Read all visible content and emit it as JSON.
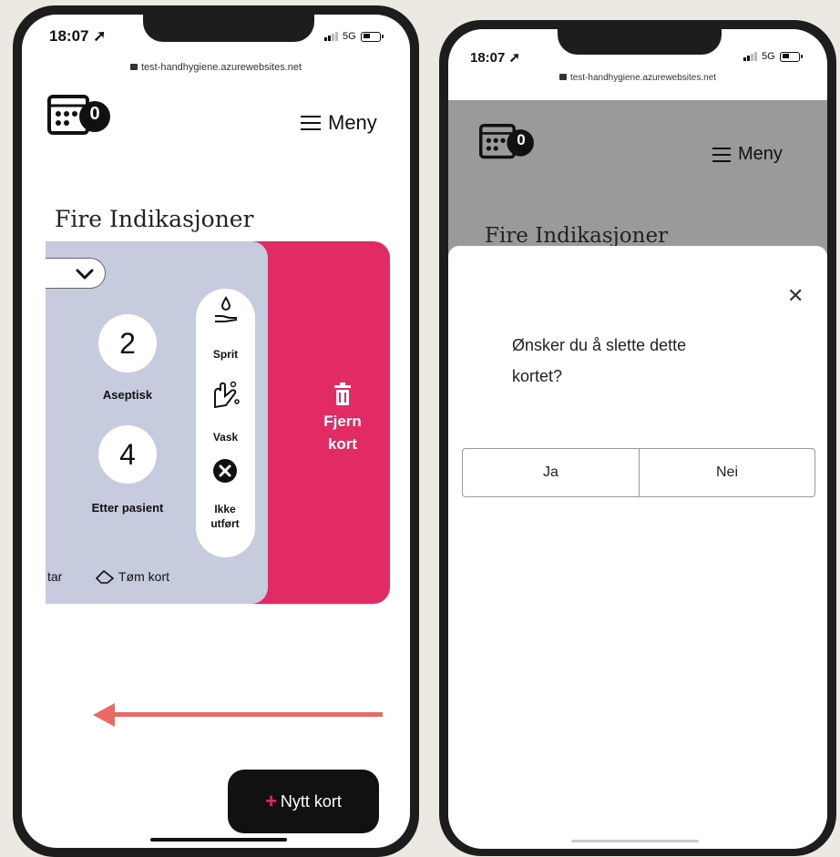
{
  "left_phone": {
    "status": {
      "time": "18:07",
      "network": "5G"
    },
    "url": "test-handhygiene.azurewebsites.net",
    "header": {
      "badge_count": "0",
      "menu_label": "Meny"
    },
    "page_title": "Fire Indikasjoner",
    "card": {
      "indications": [
        {
          "number": "2",
          "label": "Aseptisk"
        },
        {
          "number": "4",
          "label": "Etter pasient"
        }
      ],
      "actions": [
        {
          "label": "Sprit",
          "icon": "hand-sanitizer-icon"
        },
        {
          "label": "Vask",
          "icon": "hand-wash-icon"
        },
        {
          "label": "Ikke utført",
          "icon": "x-circle-icon"
        }
      ],
      "footer_left": "tar",
      "clear_label": "Tøm kort"
    },
    "delete_action": {
      "line1": "Fjern",
      "line2": "kort"
    },
    "fab_label": "Nytt kort",
    "swipe_hint_color": "#e86a63"
  },
  "right_phone": {
    "status": {
      "time": "18:07",
      "network": "5G"
    },
    "url": "test-handhygiene.azurewebsites.net",
    "header": {
      "badge_count": "0",
      "menu_label": "Meny"
    },
    "page_title": "Fire Indikasjoner",
    "dialog": {
      "line1": "Ønsker du å slette dette",
      "line2": "kortet?",
      "yes_label": "Ja",
      "no_label": "Nei"
    }
  },
  "colors": {
    "accent": "#e22a64",
    "card": "#c7cbde",
    "background": "#ece8e2"
  }
}
